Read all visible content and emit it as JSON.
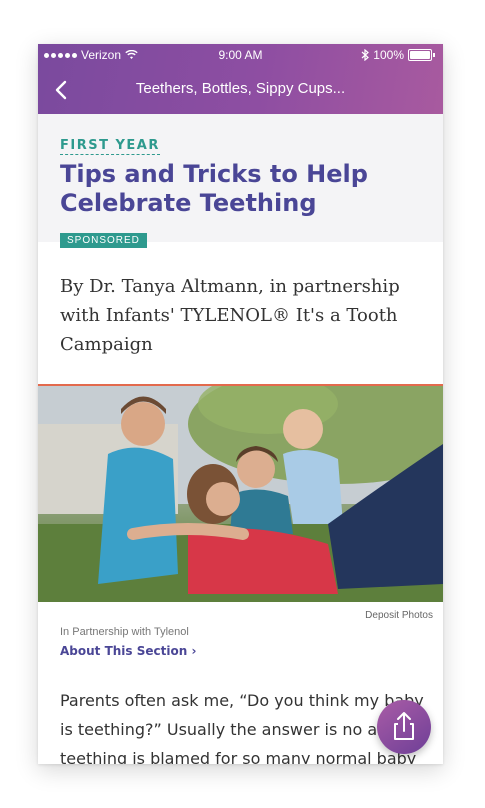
{
  "status_bar": {
    "carrier": "Verizon",
    "time": "9:00 AM",
    "battery": "100%"
  },
  "nav": {
    "title": "Teethers, Bottles, Sippy Cups..."
  },
  "article": {
    "category": "FIRST YEAR",
    "title": "Tips and Tricks to Help Celebrate Teething",
    "badge": "SPONSORED",
    "byline": "By Dr. Tanya Altmann, in partnership with Infants' TYLENOL® It's a Tooth Campaign",
    "photo_credit": "Deposit Photos",
    "partnership": "In Partnership with Tylenol",
    "section_link": "About This Section ›",
    "body": "Parents often ask me, “Do you think my baby is teething?” Usually the answer is no as teething is blamed for so many normal baby"
  },
  "icons": {
    "back": "chevron-left-icon",
    "wifi": "wifi-icon",
    "bluetooth": "bluetooth-icon",
    "battery": "battery-icon",
    "share": "share-icon"
  },
  "colors": {
    "header_gradient_start": "#7a4a9e",
    "header_gradient_end": "#a85a9f",
    "accent_teal": "#2e9a8e",
    "title_purple": "#4a4696"
  }
}
